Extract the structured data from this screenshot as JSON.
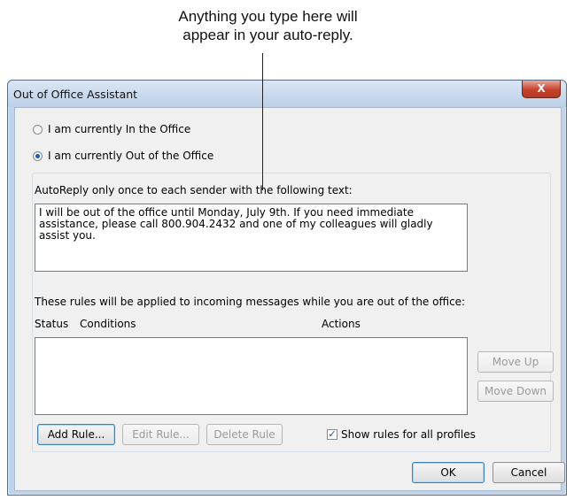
{
  "callout": {
    "line1": "Anything you type here will",
    "line2": "appear in your auto-reply."
  },
  "window": {
    "title": "Out of Office Assistant",
    "close_label": "X"
  },
  "status_options": {
    "in_office": "I am currently In the Office",
    "out_office": "I am currently Out of the Office",
    "selected": "out_office"
  },
  "autoreply": {
    "label": "AutoReply only once to each sender with the following text:",
    "text": "I will be out of the office until Monday, July 9th. If you need immediate\nassistance, please call 800.904.2432 and one of my colleagues will gladly\nassist you."
  },
  "rules": {
    "description": "These rules will be applied to incoming messages while you are out of the office:",
    "columns": [
      "Status",
      "Conditions",
      "Actions"
    ],
    "rows": []
  },
  "buttons": {
    "move_up": "Move Up",
    "move_down": "Move Down",
    "add_rule": "Add Rule...",
    "edit_rule": "Edit Rule...",
    "delete_rule": "Delete Rule",
    "ok": "OK",
    "cancel": "Cancel"
  },
  "show_all_profiles": {
    "label": "Show rules for all profiles",
    "checked": true,
    "check_glyph": "✓"
  }
}
